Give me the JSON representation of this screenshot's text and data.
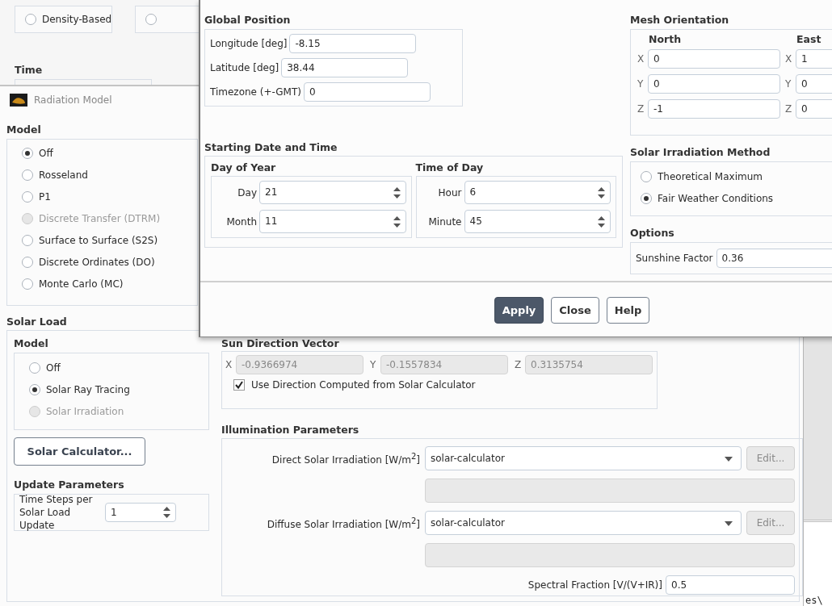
{
  "background_window": {
    "solver_options": [
      {
        "label": "Density-Based",
        "selected": false
      },
      {
        "selected": false
      }
    ],
    "time_heading": "Time"
  },
  "radiation_dialog": {
    "title": "Radiation Model",
    "model_heading": "Model",
    "models": [
      {
        "label": "Off",
        "selected": true,
        "disabled": false
      },
      {
        "label": "Rosseland",
        "selected": false,
        "disabled": false
      },
      {
        "label": "P1",
        "selected": false,
        "disabled": false
      },
      {
        "label": "Discrete Transfer (DTRM)",
        "selected": false,
        "disabled": true
      },
      {
        "label": "Surface to Surface (S2S)",
        "selected": false,
        "disabled": false
      },
      {
        "label": "Discrete Ordinates (DO)",
        "selected": false,
        "disabled": false
      },
      {
        "label": "Monte Carlo (MC)",
        "selected": false,
        "disabled": false
      }
    ],
    "solar_load": {
      "heading": "Solar Load",
      "model_heading": "Model",
      "models": [
        {
          "label": "Off",
          "selected": false,
          "disabled": false
        },
        {
          "label": "Solar Ray Tracing",
          "selected": true,
          "disabled": false
        },
        {
          "label": "Solar Irradiation",
          "selected": false,
          "disabled": true
        }
      ],
      "calculator_button": "Solar Calculator...",
      "update_heading": "Update Parameters",
      "time_steps_label": "Time Steps per Solar Load Update",
      "time_steps_value": "1",
      "sun_direction": {
        "heading": "Sun Direction Vector",
        "disabled": true,
        "components": [
          {
            "axis": "X",
            "value": "-0.9366974"
          },
          {
            "axis": "Y",
            "value": "-0.1557834"
          },
          {
            "axis": "Z",
            "value": "0.3135754"
          }
        ],
        "use_computed": {
          "label": "Use Direction Computed from Solar Calculator",
          "checked": true
        }
      },
      "illumination": {
        "heading": "Illumination Parameters",
        "sources": [
          {
            "label": "Direct Solar Irradiation [W/m$^{2}$]",
            "value": "solar-calculator",
            "edit_button": "Edit...",
            "edit_disabled": true
          },
          {
            "label": "Diffuse Solar Irradiation [W/m$^{2}$]",
            "value": "solar-calculator",
            "edit_button": "Edit...",
            "edit_disabled": true
          }
        ],
        "spectral_label": "Spectral Fraction [V/(V+IR)]",
        "spectral_value": "0.5"
      }
    }
  },
  "console": {
    "text": "es\\"
  },
  "solar_calculator": {
    "global_position": {
      "heading": "Global Position",
      "fields": [
        {
          "label": "Longitude [deg]",
          "value": "-8.15"
        },
        {
          "label": "Latitude [deg]",
          "value": "38.44"
        },
        {
          "label": "Timezone (+-GMT)",
          "value": "0"
        }
      ]
    },
    "mesh_orientation": {
      "heading": "Mesh Orientation",
      "directions": [
        {
          "heading": "North",
          "components": [
            {
              "axis": "X",
              "value": "0"
            },
            {
              "axis": "Y",
              "value": "0"
            },
            {
              "axis": "Z",
              "value": "-1"
            }
          ]
        },
        {
          "heading": "East",
          "components": [
            {
              "axis": "X",
              "value": "1"
            },
            {
              "axis": "Y",
              "value": "0"
            },
            {
              "axis": "Z",
              "value": "0"
            }
          ]
        }
      ]
    },
    "starting": {
      "heading": "Starting Date and Time",
      "groups": [
        {
          "heading": "Day of Year",
          "fields": [
            {
              "label": "Day",
              "value": "21"
            },
            {
              "label": "Month",
              "value": "11"
            }
          ]
        },
        {
          "heading": "Time of Day",
          "fields": [
            {
              "label": "Hour",
              "value": "6"
            },
            {
              "label": "Minute",
              "value": "45"
            }
          ]
        }
      ]
    },
    "irradiation_method": {
      "heading": "Solar Irradiation Method",
      "options": [
        {
          "label": "Theoretical Maximum",
          "selected": false
        },
        {
          "label": "Fair Weather Conditions",
          "selected": true
        }
      ]
    },
    "options": {
      "heading": "Options",
      "sunshine_label": "Sunshine Factor",
      "sunshine_value": "0.36"
    },
    "buttons": [
      {
        "label": "Apply",
        "primary": true
      },
      {
        "label": "Close",
        "primary": false
      },
      {
        "label": "Help",
        "primary": false
      }
    ]
  }
}
